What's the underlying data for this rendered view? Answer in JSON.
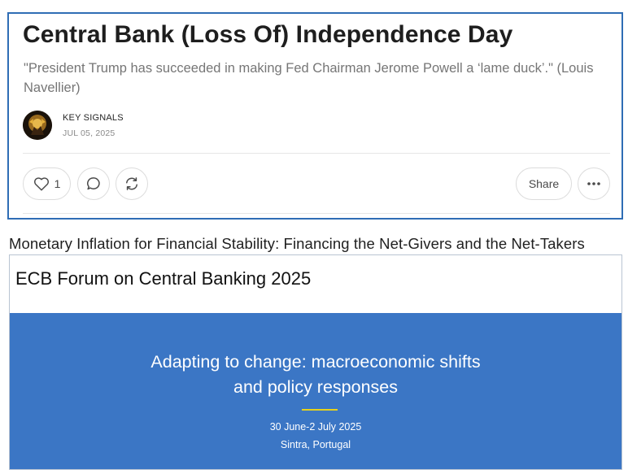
{
  "post": {
    "title": "Central Bank (Loss Of) Independence Day",
    "subtitle": "\"President Trump has succeeded in making Fed Chairman Jerome Powell a ‘lame duck’.\" (Louis Navellier)",
    "author": "KEY SIGNALS",
    "date": "JUL 05, 2025",
    "actions": {
      "like_icon": "heart-icon",
      "like_count": "1",
      "comment_icon": "comment-bubble-icon",
      "restack_icon": "restack-arrows-icon",
      "share_label": "Share",
      "more_icon": "ellipsis-icon"
    }
  },
  "forum": {
    "heading": "Monetary Inflation for Financial Stability: Financing the Net-Givers and the Net-Takers",
    "title": "ECB Forum on Central Banking 2025",
    "headline_line1": "Adapting to change: macroeconomic shifts",
    "headline_line2": "and policy responses",
    "dates": "30 June-2 July 2025",
    "location": "Sintra, Portugal"
  },
  "colors": {
    "card_border": "#2f6db5",
    "banner_blue": "#3b76c5",
    "accent_rule": "#e6d21d"
  }
}
